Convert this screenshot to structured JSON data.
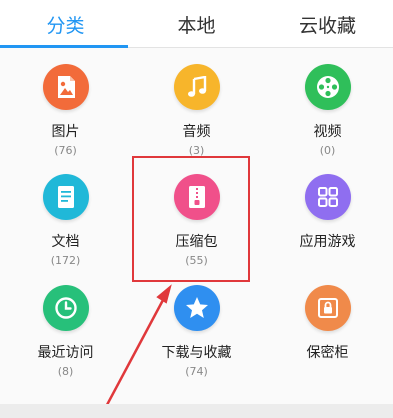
{
  "tabs": [
    {
      "label": "分类",
      "active": true
    },
    {
      "label": "本地",
      "active": false
    },
    {
      "label": "云收藏",
      "active": false
    }
  ],
  "categories": [
    {
      "label": "图片",
      "count": "(76)",
      "icon": "image-icon",
      "color": "#f26b3a"
    },
    {
      "label": "音频",
      "count": "(3)",
      "icon": "music-note-icon",
      "color": "#f7b52b"
    },
    {
      "label": "视频",
      "count": "(0)",
      "icon": "film-reel-icon",
      "color": "#2fbf5a"
    },
    {
      "label": "文档",
      "count": "(172)",
      "icon": "document-icon",
      "color": "#20b8d8"
    },
    {
      "label": "压缩包",
      "count": "(55)",
      "icon": "zip-archive-icon",
      "color": "#f0508a"
    },
    {
      "label": "应用游戏",
      "count": "",
      "icon": "apps-grid-icon",
      "color": "#8f6ef0"
    },
    {
      "label": "最近访问",
      "count": "(8)",
      "icon": "clock-icon",
      "color": "#27c07a"
    },
    {
      "label": "下载与收藏",
      "count": "(74)",
      "icon": "star-icon",
      "color": "#2f8ff0"
    },
    {
      "label": "保密柜",
      "count": "",
      "icon": "safe-lock-icon",
      "color": "#f08a4a"
    }
  ],
  "colors": {
    "accent": "#2196f3",
    "highlight": "#e0383b"
  }
}
